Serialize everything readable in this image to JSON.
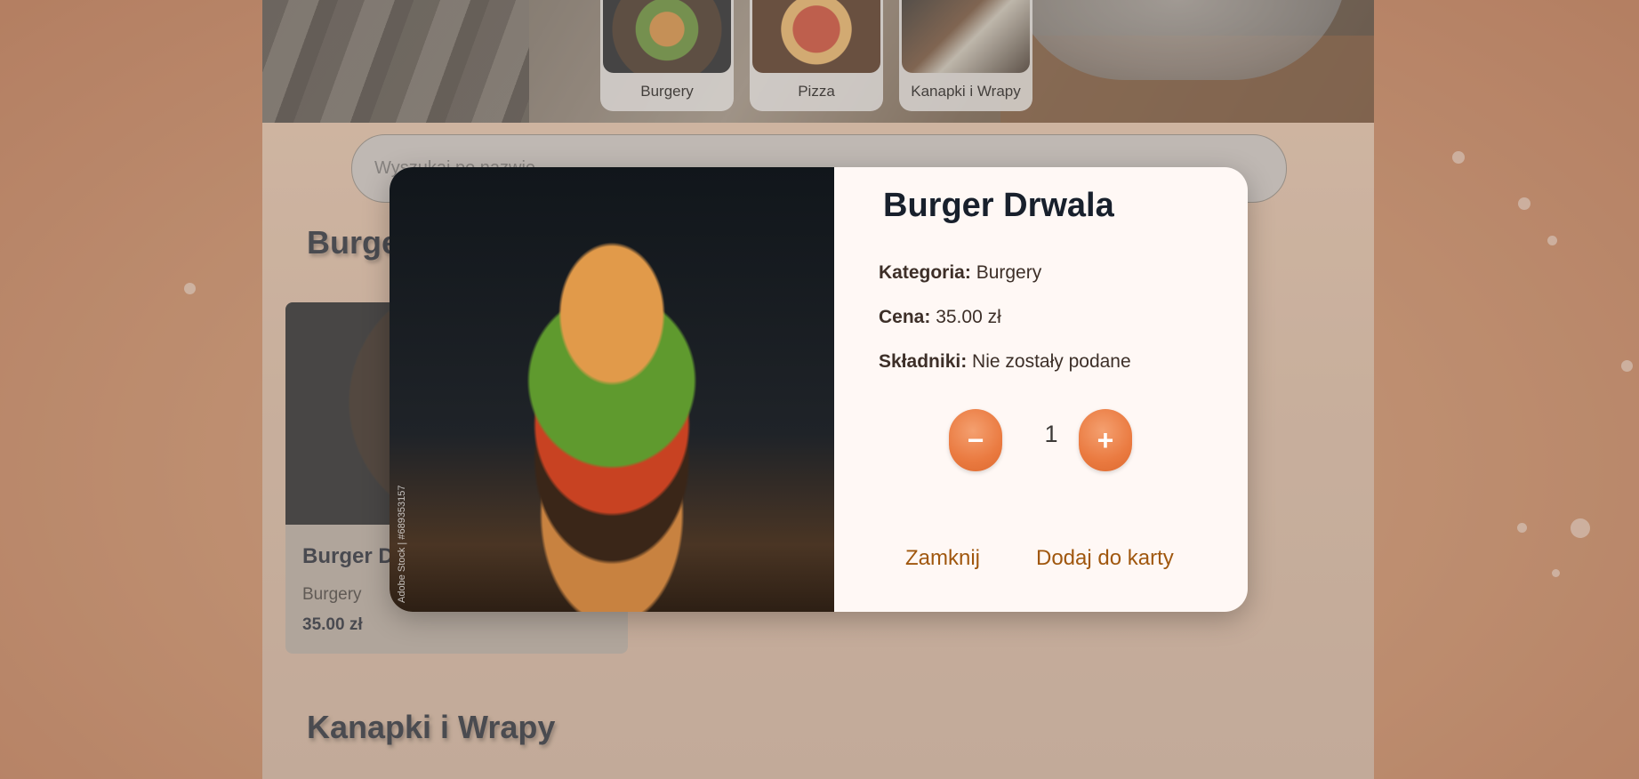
{
  "categories": [
    {
      "label": "Burgery",
      "image": "burger-photo"
    },
    {
      "label": "Pizza",
      "image": "pizza-photo"
    },
    {
      "label": "Kanapki i Wrapy",
      "image": "sushi-wraps-photo"
    }
  ],
  "search": {
    "placeholder": "Wyszukaj po nazwie..."
  },
  "sections": {
    "burgers_title": "Burgery",
    "wraps_title": "Kanapki i Wrapy"
  },
  "card": {
    "name": "Burger Drwala",
    "category": "Burgery",
    "price": "35.00 zł"
  },
  "modal": {
    "title": "Burger Drwala",
    "category_label": "Kategoria:",
    "category_value": "Burgery",
    "price_label": "Cena:",
    "price_value": "35.00 zł",
    "ingredients_label": "Składniki:",
    "ingredients_value": "Nie zostały podane",
    "quantity": "1",
    "minus": "−",
    "plus": "+",
    "close_label": "Zamknij",
    "add_label": "Dodaj do karty",
    "watermark": "Adobe Stock | #689353157"
  },
  "colors": {
    "accent": "#ea7a40",
    "action_text": "#a0570e",
    "title_text": "#18202c"
  }
}
